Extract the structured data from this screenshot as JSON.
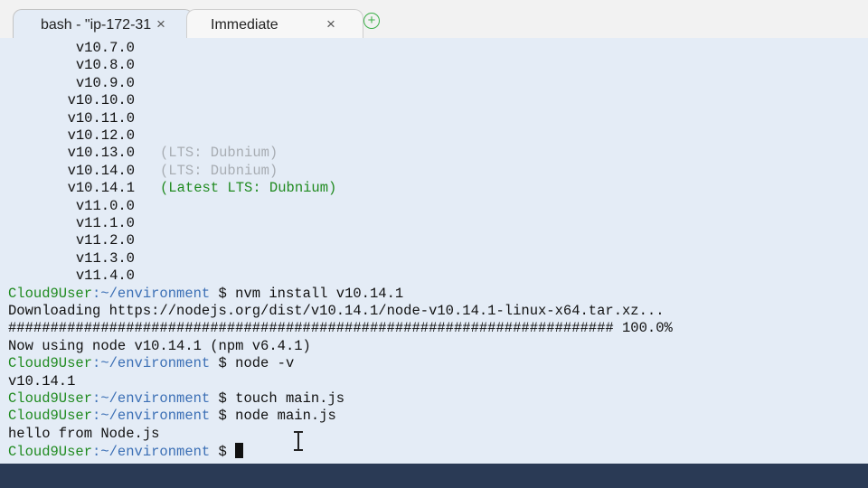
{
  "tabs": [
    {
      "label": "bash - \"ip-172-31",
      "close": "×"
    },
    {
      "label": "Immediate",
      "close": "×"
    }
  ],
  "new_tab_icon": "+",
  "terminal": {
    "versions": [
      {
        "v": "v10.7.0",
        "note": "",
        "style": ""
      },
      {
        "v": "v10.8.0",
        "note": "",
        "style": ""
      },
      {
        "v": "v10.9.0",
        "note": "",
        "style": ""
      },
      {
        "v": "v10.10.0",
        "note": "",
        "style": ""
      },
      {
        "v": "v10.11.0",
        "note": "",
        "style": ""
      },
      {
        "v": "v10.12.0",
        "note": "",
        "style": ""
      },
      {
        "v": "v10.13.0",
        "note": "(LTS: Dubnium)",
        "style": "gray"
      },
      {
        "v": "v10.14.0",
        "note": "(LTS: Dubnium)",
        "style": "gray"
      },
      {
        "v": "v10.14.1",
        "note": "(Latest LTS: Dubnium)",
        "style": "green"
      },
      {
        "v": "v11.0.0",
        "note": "",
        "style": ""
      },
      {
        "v": "v11.1.0",
        "note": "",
        "style": ""
      },
      {
        "v": "v11.2.0",
        "note": "",
        "style": ""
      },
      {
        "v": "v11.3.0",
        "note": "",
        "style": ""
      },
      {
        "v": "v11.4.0",
        "note": "",
        "style": ""
      }
    ],
    "prompt_user": "Cloud9User",
    "prompt_path": ":~/environment",
    "prompt_symbol": " $ ",
    "session": [
      {
        "type": "cmd",
        "text": "nvm install v10.14.1"
      },
      {
        "type": "out",
        "text": "Downloading https://nodejs.org/dist/v10.14.1/node-v10.14.1-linux-x64.tar.xz..."
      },
      {
        "type": "out",
        "text": "######################################################################## 100.0%"
      },
      {
        "type": "out",
        "text": "Now using node v10.14.1 (npm v6.4.1)"
      },
      {
        "type": "cmd",
        "text": "node -v"
      },
      {
        "type": "out",
        "text": "v10.14.1"
      },
      {
        "type": "cmd",
        "text": "touch main.js"
      },
      {
        "type": "cmd",
        "text": "node main.js"
      },
      {
        "type": "out",
        "text": "hello from Node.js"
      },
      {
        "type": "cmd",
        "text": ""
      }
    ]
  },
  "colors": {
    "terminal_bg": "#e4ecf6",
    "prompt_user": "#1f8a1f",
    "prompt_path": "#3b6fb5",
    "lts_gray": "#a8adb3",
    "lts_green": "#1f8a1f"
  }
}
